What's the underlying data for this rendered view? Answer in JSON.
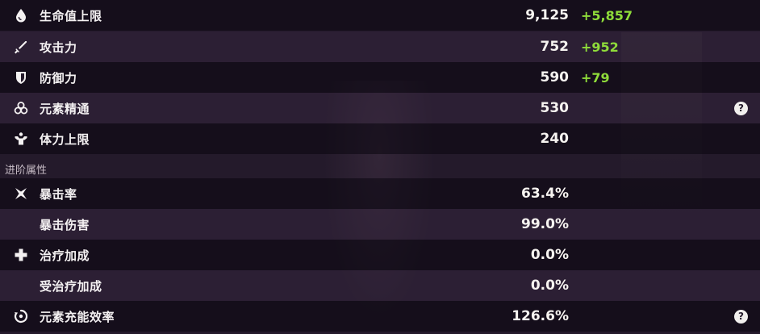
{
  "base_stats": [
    {
      "label": "生命值上限",
      "value": "9,125",
      "bonus": "+5,857",
      "icon": "water-drop-icon",
      "help": false
    },
    {
      "label": "攻击力",
      "value": "752",
      "bonus": "+952",
      "icon": "sword-icon",
      "help": false
    },
    {
      "label": "防御力",
      "value": "590",
      "bonus": "+79",
      "icon": "shield-icon",
      "help": false
    },
    {
      "label": "元素精通",
      "value": "530",
      "bonus": "",
      "icon": "elemental-mastery-icon",
      "help": true
    },
    {
      "label": "体力上限",
      "value": "240",
      "bonus": "",
      "icon": "stamina-icon",
      "help": false
    }
  ],
  "advanced_title": "进阶属性",
  "advanced_stats": [
    {
      "label": "暴击率",
      "value": "63.4%",
      "icon": "crit-star-icon",
      "help": false
    },
    {
      "label": "暴击伤害",
      "value": "99.0%",
      "icon": "",
      "help": false
    },
    {
      "label": "治疗加成",
      "value": "0.0%",
      "icon": "healing-cross-icon",
      "help": false
    },
    {
      "label": "受治疗加成",
      "value": "0.0%",
      "icon": "",
      "help": false
    },
    {
      "label": "元素充能效率",
      "value": "126.6%",
      "icon": "energy-recharge-icon",
      "help": true
    }
  ],
  "help_glyph": "?",
  "colors": {
    "bonus": "#8fdc3a",
    "background": "#241a2b"
  }
}
